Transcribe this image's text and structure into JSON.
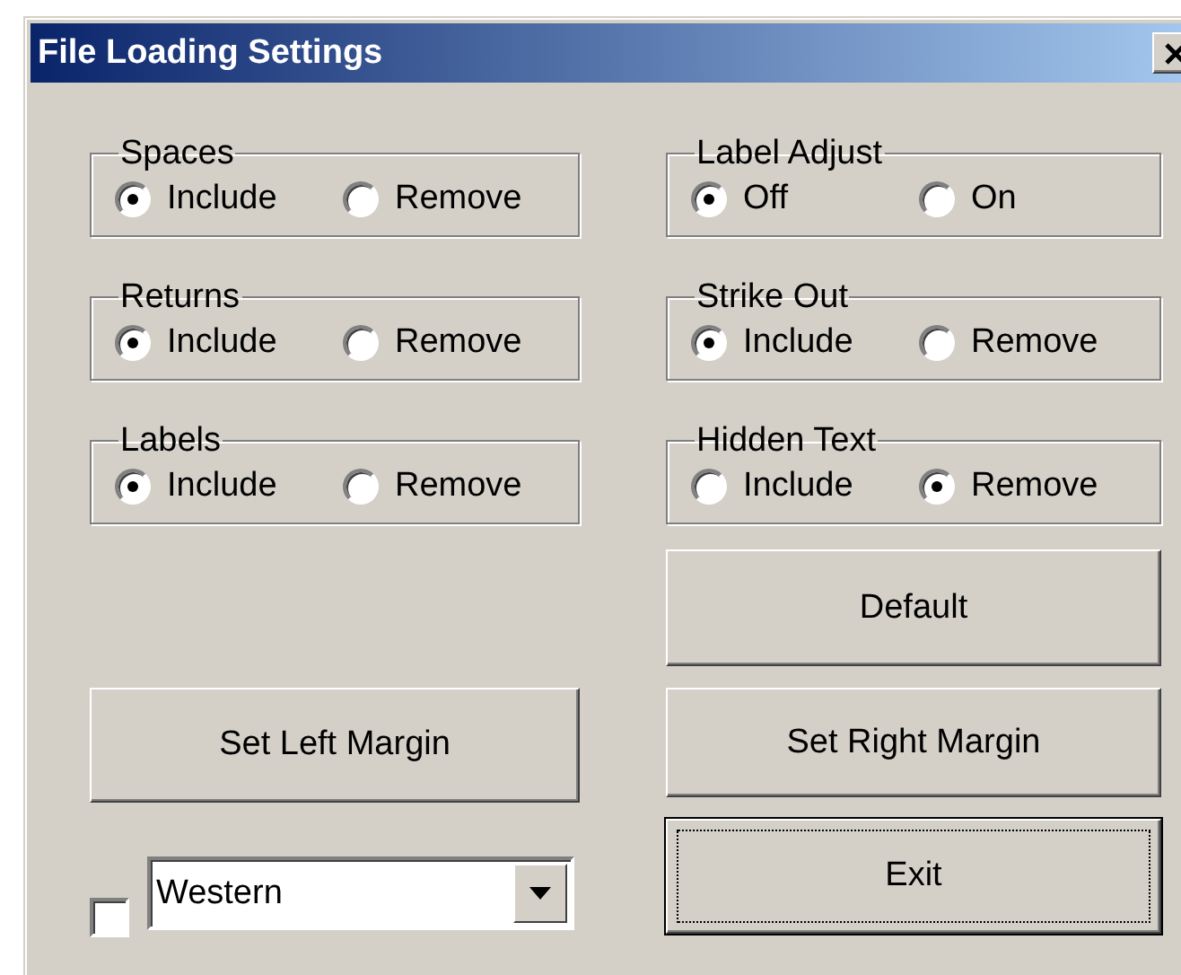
{
  "window": {
    "title": "File Loading Settings"
  },
  "groups": [
    {
      "label": "Spaces",
      "options": [
        {
          "label": "Include",
          "selected": true
        },
        {
          "label": "Remove",
          "selected": false
        }
      ]
    },
    {
      "label": "Label Adjust",
      "options": [
        {
          "label": "Off",
          "selected": true
        },
        {
          "label": "On",
          "selected": false
        }
      ]
    },
    {
      "label": "Returns",
      "options": [
        {
          "label": "Include",
          "selected": true
        },
        {
          "label": "Remove",
          "selected": false
        }
      ]
    },
    {
      "label": "Strike Out",
      "options": [
        {
          "label": "Include",
          "selected": true
        },
        {
          "label": "Remove",
          "selected": false
        }
      ]
    },
    {
      "label": "Labels",
      "options": [
        {
          "label": "Include",
          "selected": true
        },
        {
          "label": "Remove",
          "selected": false
        }
      ]
    },
    {
      "label": "Hidden Text",
      "options": [
        {
          "label": "Include",
          "selected": false
        },
        {
          "label": "Remove",
          "selected": true
        }
      ]
    }
  ],
  "buttons": [
    {
      "label": "Default",
      "focused": false
    },
    {
      "label": "Set Left Margin",
      "focused": false
    },
    {
      "label": "Set Right Margin",
      "focused": false
    },
    {
      "label": "Exit",
      "focused": true
    }
  ],
  "checkbox": {
    "checked": false
  },
  "dropdown": {
    "value": "Western"
  }
}
